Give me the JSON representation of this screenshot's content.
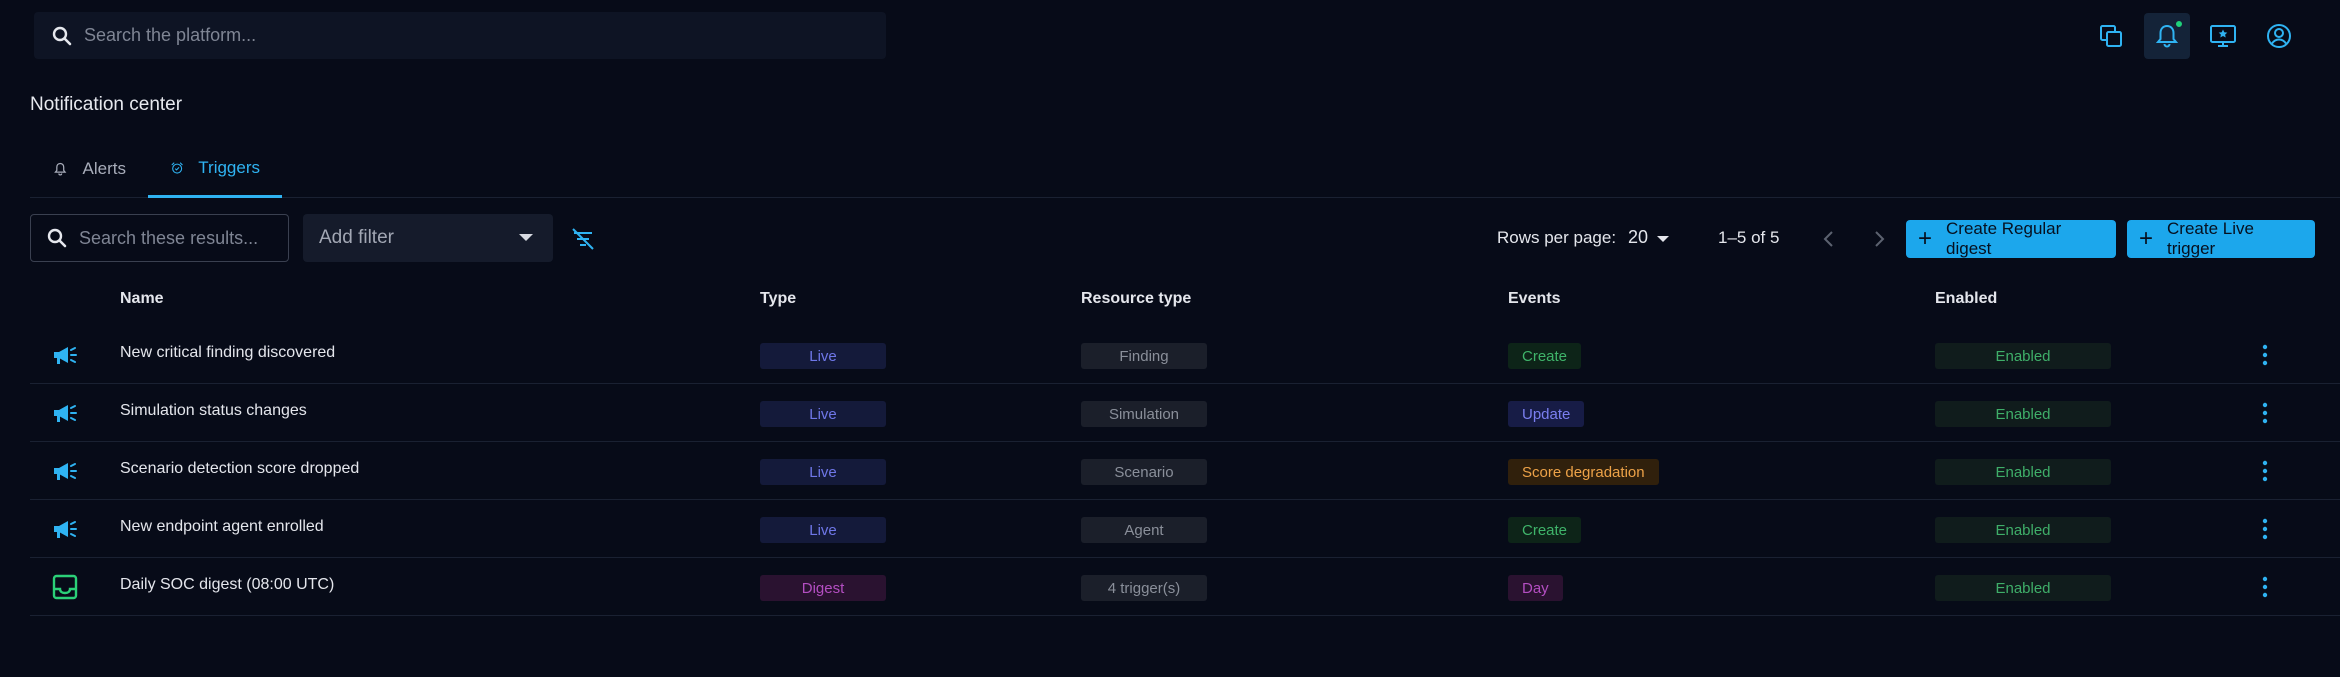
{
  "header": {
    "search_placeholder": "Search the platform..."
  },
  "page": {
    "title": "Notification center"
  },
  "tabs": [
    {
      "label": "Alerts",
      "icon": "bell-icon",
      "active": false
    },
    {
      "label": "Triggers",
      "icon": "alarm-icon",
      "active": true
    }
  ],
  "toolbar": {
    "search_placeholder": "Search these results...",
    "add_filter_label": "Add filter",
    "rows_per_page_label": "Rows per page:",
    "rows_per_page_value": "20",
    "range_label": "1–5 of 5",
    "create_digest_label": "Create Regular digest",
    "create_live_label": "Create Live trigger"
  },
  "table": {
    "columns": [
      "Name",
      "Type",
      "Resource type",
      "Events",
      "Enabled"
    ],
    "rows": [
      {
        "icon": "megaphone-icon",
        "name": "New critical finding discovered",
        "type": "Live",
        "resource": "Finding",
        "event": "Create",
        "enabled": "Enabled"
      },
      {
        "icon": "megaphone-icon",
        "name": "Simulation status changes",
        "type": "Live",
        "resource": "Simulation",
        "event": "Update",
        "enabled": "Enabled"
      },
      {
        "icon": "megaphone-icon",
        "name": "Scenario detection score dropped",
        "type": "Live",
        "resource": "Scenario",
        "event": "Score degradation",
        "enabled": "Enabled"
      },
      {
        "icon": "megaphone-icon",
        "name": "New endpoint agent enrolled",
        "type": "Live",
        "resource": "Agent",
        "event": "Create",
        "enabled": "Enabled"
      },
      {
        "icon": "inbox-icon",
        "name": "Daily SOC digest (08:00 UTC)",
        "type": "Digest",
        "resource": "4 trigger(s)",
        "event": "Day",
        "enabled": "Enabled"
      }
    ]
  },
  "colors": {
    "accent": "#1ca7ec",
    "background": "#070b18",
    "notification_dot": "#1fd17a"
  }
}
